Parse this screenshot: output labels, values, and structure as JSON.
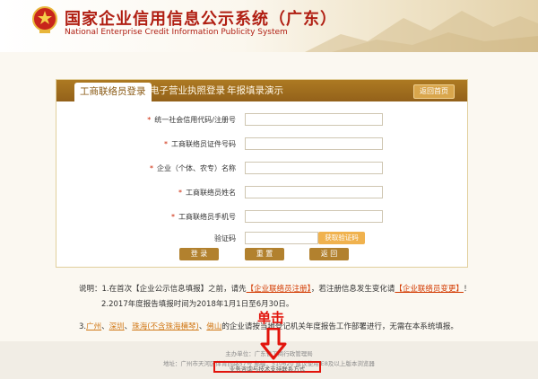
{
  "header": {
    "title_cn": "国家企业信用信息公示系统（广东）",
    "title_en": "National Enterprise Credit Information Publicity System",
    "emblem_icon": "national-emblem-icon"
  },
  "tabs": [
    {
      "label": "工商联络员登录",
      "active": true
    },
    {
      "label": "电子营业执照登录",
      "active": false
    },
    {
      "label": "年报填录演示",
      "active": false
    }
  ],
  "back_home_label": "返回首页",
  "form": {
    "fields": [
      {
        "label": "统一社会信用代码/注册号",
        "required": true,
        "value": ""
      },
      {
        "label": "工商联络员证件号码",
        "required": true,
        "value": ""
      },
      {
        "label": "企业（个体、农专）名称",
        "required": true,
        "value": ""
      },
      {
        "label": "工商联络员姓名",
        "required": true,
        "value": ""
      },
      {
        "label": "工商联络员手机号",
        "required": true,
        "value": ""
      }
    ],
    "verification": {
      "label": "验证码",
      "value": "",
      "button_label": "获取验证码"
    },
    "buttons": {
      "login": "登 录",
      "reset": "重 置",
      "back": "返 回"
    }
  },
  "notes": {
    "line1": {
      "prefix": "说明：1.在首次【企业公示信息填报】之前，请先",
      "link1": "【企业联络员注册】",
      "middle": "，若注册信息发生变化请",
      "link2": "【企业联络员变更】",
      "suffix": "！"
    },
    "line2": "2.2017年度报告填报时间为2018年1月1日至6月30日。",
    "line3": {
      "prefix": "3.",
      "city1": "广州",
      "sep1": "、",
      "city2": "深圳",
      "sep2": "、",
      "city3": "珠海(不含珠海横琴)",
      "sep3": "、",
      "city4": "佛山",
      "suffix": "的企业请按当地登记机关年度报告工作部署进行，无需在本系统填报。"
    }
  },
  "annotation": {
    "text": "单击",
    "color": "#e2140c"
  },
  "footer": {
    "line1": "主办单位：广东省工商行政管理局",
    "line2": "地址：广州市天河区体育西路57号  邮编：510620  建议使用IE8及以上版本浏览器",
    "highlight": "业务咨询与技术支持联系方式"
  },
  "colors": {
    "brand_red": "#b01e12",
    "tab_bar": "#a0701f",
    "button": "#b2812e",
    "get_code": "#f0b24e",
    "link": "#d33a00"
  }
}
